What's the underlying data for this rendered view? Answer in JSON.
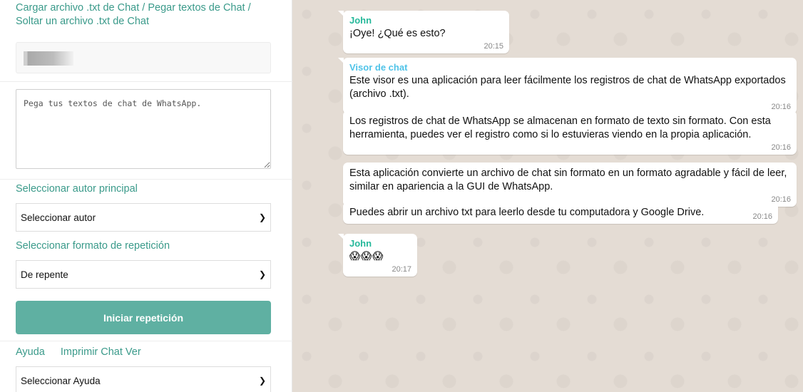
{
  "sidebar": {
    "load_links_line1": "Cargar archivo .txt de Chat / Pegar textos de Chat /",
    "load_links_line2": "Soltar un archivo .txt de Chat",
    "textarea_placeholder": "Pega tus textos de chat de WhatsApp.",
    "author_label": "Seleccionar autor principal",
    "author_select_value": "Seleccionar autor",
    "format_label": "Seleccionar formato de repetición",
    "format_select_value": "De repente",
    "start_button": "Iniciar repetición",
    "help_link": "Ayuda",
    "print_link": "Imprimir Chat Ver",
    "help_select_value": "Seleccionar Ayuda"
  },
  "chat": {
    "messages": [
      {
        "author": "John",
        "text": "¡Oye! ¿Qué es esto?",
        "time": "20:15"
      },
      {
        "author": "Visor de chat",
        "text": "Este visor es una aplicación para leer fácilmente los registros de chat de WhatsApp exportados (archivo .txt).",
        "time": "20:16"
      },
      {
        "author": "",
        "text": "Los registros de chat de WhatsApp se almacenan en formato de texto sin formato. Con esta herramienta, puedes ver el registro como si lo estuvieras viendo en la propia aplicación.",
        "time": "20:16"
      },
      {
        "author": "",
        "text": "Esta aplicación convierte un archivo de chat sin formato en un formato agradable y fácil de leer, similar en apariencia a la GUI de WhatsApp.",
        "time": "20:16"
      },
      {
        "author": "",
        "text": "Puedes abrir un archivo txt para leerlo desde tu computadora y Google Drive.",
        "time": "20:16"
      },
      {
        "author": "John",
        "text": "😱😱😱",
        "time": "20:17"
      }
    ]
  },
  "colors": {
    "accent": "#3a9a8a",
    "button": "#5fb0a2",
    "chat_bg": "#e4dcd4",
    "john_name": "#25b89a",
    "visor_name": "#4fc3e8"
  }
}
